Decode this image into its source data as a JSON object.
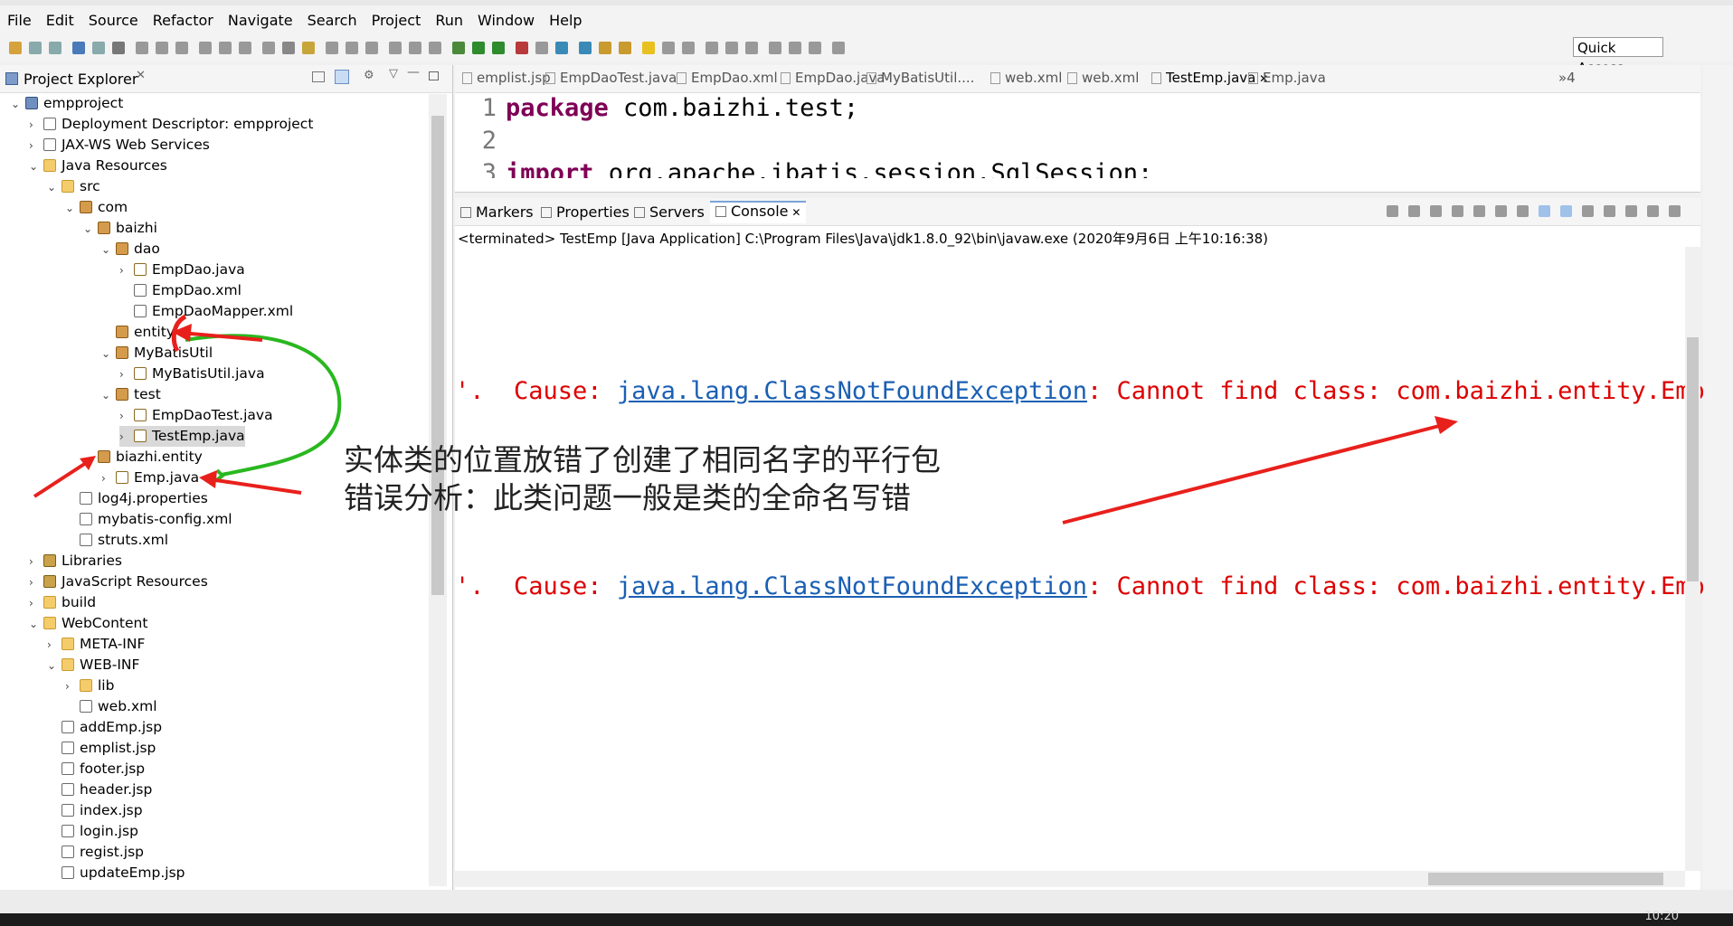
{
  "menu": [
    "File",
    "Edit",
    "Source",
    "Refactor",
    "Navigate",
    "Search",
    "Project",
    "Run",
    "Window",
    "Help"
  ],
  "toolbar": {
    "quick_access": "Quick Access"
  },
  "explorer": {
    "title": "Project Explorer",
    "tree": [
      {
        "label": "empproject",
        "arrow": "v",
        "icon": "proj"
      },
      {
        "label": "Deployment Descriptor: empproject",
        "arrow": ">",
        "icon": "file"
      },
      {
        "label": "JAX-WS Web Services",
        "arrow": ">",
        "icon": "file"
      },
      {
        "label": "Java Resources",
        "arrow": "v",
        "icon": "folder"
      },
      {
        "label": "src",
        "arrow": "v",
        "icon": "folder"
      },
      {
        "label": "com",
        "arrow": "v",
        "icon": "pkg"
      },
      {
        "label": "baizhi",
        "arrow": "v",
        "icon": "pkg"
      },
      {
        "label": "dao",
        "arrow": "v",
        "icon": "pkg"
      },
      {
        "label": "EmpDao.java",
        "arrow": ">",
        "icon": "java"
      },
      {
        "label": "EmpDao.xml",
        "arrow": "",
        "icon": "file"
      },
      {
        "label": "EmpDaoMapper.xml",
        "arrow": "",
        "icon": "file"
      },
      {
        "label": "entity",
        "arrow": "",
        "icon": "pkg"
      },
      {
        "label": "MyBatisUtil",
        "arrow": "v",
        "icon": "pkg"
      },
      {
        "label": "MyBatisUtil.java",
        "arrow": ">",
        "icon": "java"
      },
      {
        "label": "test",
        "arrow": "v",
        "icon": "pkg"
      },
      {
        "label": "EmpDaoTest.java",
        "arrow": ">",
        "icon": "java"
      },
      {
        "label": "TestEmp.java",
        "arrow": ">",
        "icon": "java"
      },
      {
        "label": "biazhi.entity",
        "arrow": "v",
        "icon": "pkg"
      },
      {
        "label": "Emp.java",
        "arrow": ">",
        "icon": "java"
      },
      {
        "label": "log4j.properties",
        "arrow": "",
        "icon": "file"
      },
      {
        "label": "mybatis-config.xml",
        "arrow": "",
        "icon": "file"
      },
      {
        "label": "struts.xml",
        "arrow": "",
        "icon": "file"
      },
      {
        "label": "Libraries",
        "arrow": ">",
        "icon": "lib"
      },
      {
        "label": "JavaScript Resources",
        "arrow": ">",
        "icon": "lib"
      },
      {
        "label": "build",
        "arrow": ">",
        "icon": "folder"
      },
      {
        "label": "WebContent",
        "arrow": "v",
        "icon": "folder"
      },
      {
        "label": "META-INF",
        "arrow": ">",
        "icon": "folder"
      },
      {
        "label": "WEB-INF",
        "arrow": "v",
        "icon": "folder"
      },
      {
        "label": "lib",
        "arrow": ">",
        "icon": "folder"
      },
      {
        "label": "web.xml",
        "arrow": "",
        "icon": "file"
      },
      {
        "label": "addEmp.jsp",
        "arrow": "",
        "icon": "file"
      },
      {
        "label": "emplist.jsp",
        "arrow": "",
        "icon": "file"
      },
      {
        "label": "footer.jsp",
        "arrow": "",
        "icon": "file"
      },
      {
        "label": "header.jsp",
        "arrow": "",
        "icon": "file"
      },
      {
        "label": "index.jsp",
        "arrow": "",
        "icon": "file"
      },
      {
        "label": "login.jsp",
        "arrow": "",
        "icon": "file"
      },
      {
        "label": "regist.jsp",
        "arrow": "",
        "icon": "file"
      },
      {
        "label": "updateEmp.jsp",
        "arrow": "",
        "icon": "file"
      }
    ]
  },
  "editor": {
    "tabs": [
      "emplist.jsp",
      "EmpDaoTest.java",
      "EmpDao.xml",
      "EmpDao.java",
      "MyBatisUtil....",
      "web.xml",
      "web.xml",
      "TestEmp.java",
      "Emp.java"
    ],
    "active_tab": "TestEmp.java",
    "overflow": "»4",
    "lines": [
      {
        "no": "1",
        "keyword": "package",
        "rest": " com.baizhi.test;"
      },
      {
        "no": "2",
        "keyword": "",
        "rest": ""
      },
      {
        "no": "3",
        "keyword": "import",
        "rest": " org.apache.ibatis.session.SqlSession;"
      }
    ]
  },
  "console": {
    "tabs": [
      "Markers",
      "Properties",
      "Servers",
      "Console"
    ],
    "active_tab": "Console",
    "status": "<terminated> TestEmp [Java Application] C:\\Program Files\\Java\\jdk1.8.0_92\\bin\\javaw.exe (2020年9月6日 上午10:16:38)",
    "error_prefix": "'.  Cause: ",
    "error_link": "java.lang.ClassNotFoundException",
    "error_suffix": ": Cannot find class: com.baizhi.entity.Emp"
  },
  "annotation": {
    "line1": "实体类的位置放错了创建了相同名字的平行包",
    "line2": "错误分析：此类问题一般是类的全命名写错"
  },
  "taskbar": {
    "time": "10:20"
  }
}
